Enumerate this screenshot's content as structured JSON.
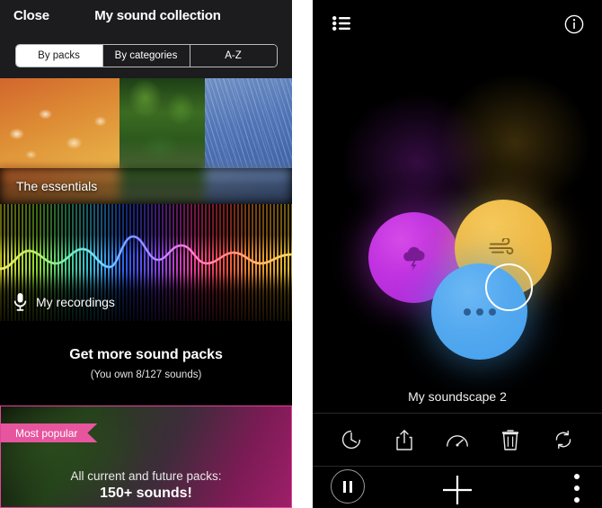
{
  "left": {
    "nav": {
      "close_label": "Close",
      "title": "My sound collection"
    },
    "segmented": {
      "options": [
        {
          "label": "By packs",
          "selected": true
        },
        {
          "label": "By categories",
          "selected": false
        },
        {
          "label": "A-Z",
          "selected": false
        }
      ]
    },
    "cards": {
      "essentials": {
        "label": "The essentials",
        "panels": [
          "meadow",
          "forest",
          "rain"
        ]
      },
      "recordings": {
        "label": "My recordings",
        "icon": "microphone-icon"
      },
      "get_more": {
        "title": "Get more sound packs",
        "subtitle": "(You own 8/127 sounds)"
      },
      "promo": {
        "ribbon": "Most popular",
        "line1": "All current and future packs:",
        "line2": "150+ sounds!",
        "ribbon_color": "#e8559f",
        "border_color": "#e0459a"
      }
    }
  },
  "right": {
    "top": {
      "list_icon": "list-icon",
      "info_icon": "info-icon"
    },
    "mixer": {
      "bubbles": [
        {
          "name": "thunderstorm",
          "icon": "thunderstorm-cloud-icon",
          "color": "#b92ed8",
          "selected": false
        },
        {
          "name": "wind",
          "icon": "wind-icon",
          "color": "#edb843",
          "selected": true
        },
        {
          "name": "more-sounds",
          "icon": "three-dots-icon",
          "color": "#4ea4ee",
          "selected": false
        }
      ]
    },
    "soundscape_name": "My soundscape 2",
    "tools": [
      {
        "name": "timer",
        "icon": "timer-icon"
      },
      {
        "name": "share",
        "icon": "share-icon"
      },
      {
        "name": "speed",
        "icon": "gauge-icon"
      },
      {
        "name": "delete",
        "icon": "trash-icon"
      },
      {
        "name": "loop",
        "icon": "loop-icon"
      }
    ],
    "bottom": {
      "pause": "pause-icon",
      "add": "plus-icon",
      "menu": "kebab-menu-icon"
    }
  }
}
